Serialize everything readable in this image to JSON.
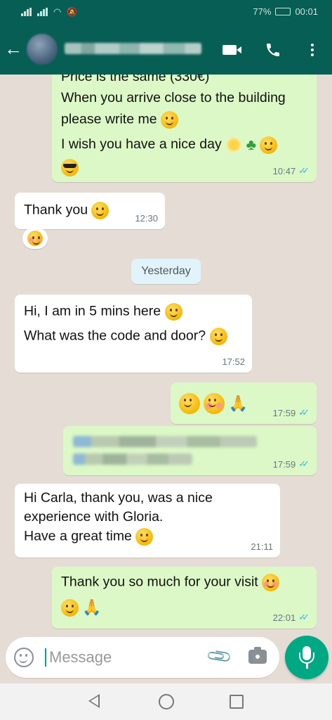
{
  "status_bar": {
    "battery": "77%",
    "time": "00:01"
  },
  "header": {
    "contact_name": "",
    "avatar": "blurred contact photo"
  },
  "messages": [
    {
      "lines": [
        "Price is the same (330€)",
        "When you arrive close to the building",
        "please write me",
        "I wish you have a nice day"
      ],
      "time": "10:47",
      "direction": "out"
    },
    {
      "lines": [
        "Thank you"
      ],
      "time": "12:30",
      "direction": "in"
    },
    {
      "lines": [
        "Hi, I am in 5 mins here",
        "What was the code and door?"
      ],
      "time": "17:52",
      "direction": "in"
    },
    {
      "lines": [
        ""
      ],
      "time": "17:59",
      "direction": "out"
    },
    {
      "lines": [],
      "time": "17:59",
      "direction": "out"
    },
    {
      "lines": [
        "Hi Carla, thank you, was a nice",
        "experience with Gloria.",
        "Have a great time"
      ],
      "time": "21:11",
      "direction": "in"
    },
    {
      "lines": [
        "Thank you so much for your visit"
      ],
      "time": "22:01",
      "direction": "out"
    }
  ],
  "date_divider": "Yesterday",
  "input": {
    "placeholder": "Message"
  },
  "icons": {
    "back": "arrow-left-icon",
    "video": "video-camera-icon",
    "call": "phone-icon",
    "menu": "more-vert-icon",
    "emoji": "emoji-icon",
    "attach": "paperclip-icon",
    "camera": "camera-icon",
    "mic": "mic-icon"
  },
  "colors": {
    "header": "#075e54",
    "outgoing": "#dcf8c6",
    "incoming": "#ffffff",
    "accent": "#00a884",
    "read_ticks": "#34b7f1"
  }
}
